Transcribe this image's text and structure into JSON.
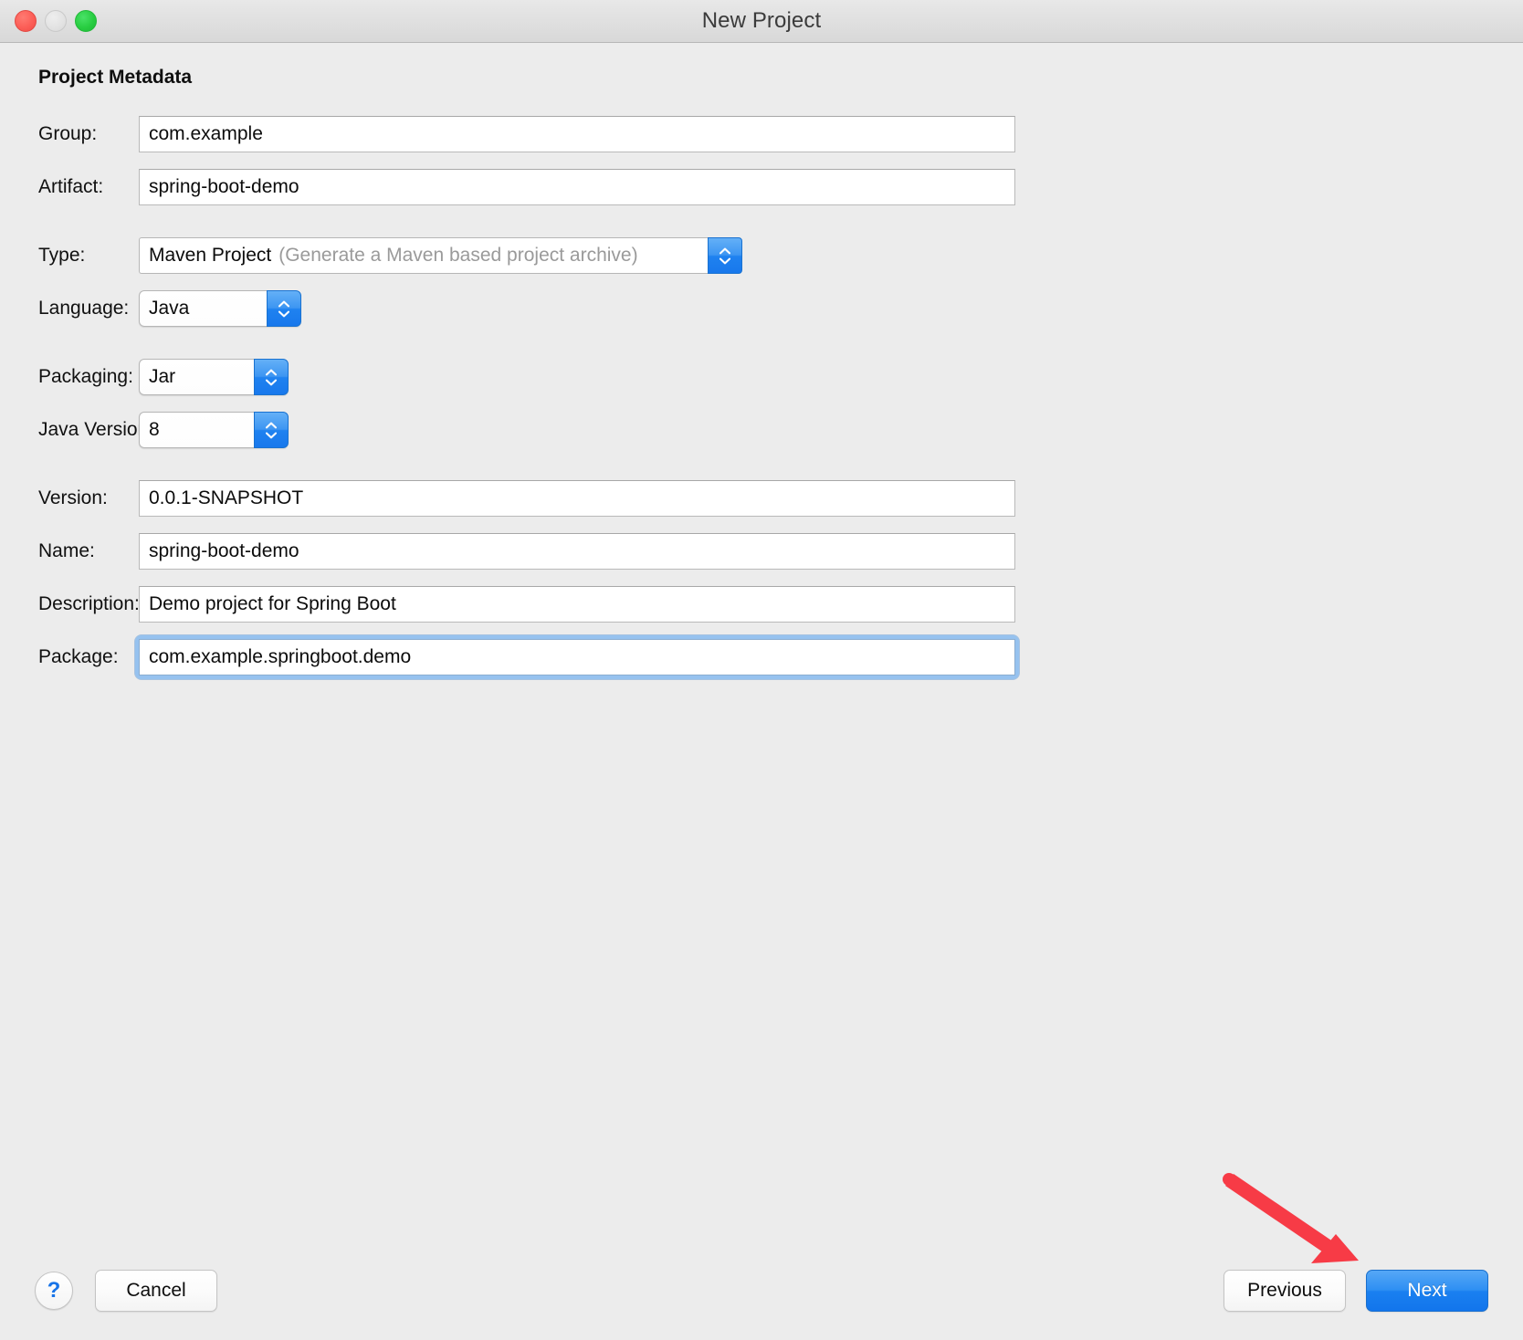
{
  "window": {
    "title": "New Project",
    "traffic_lights": [
      {
        "name": "close",
        "color": "#fc5e57"
      },
      {
        "name": "minimize",
        "color": "#e2e2e2"
      },
      {
        "name": "zoom",
        "color": "#28cd41"
      }
    ]
  },
  "section": {
    "title": "Project Metadata"
  },
  "form": {
    "fields": [
      {
        "label": "Group:",
        "value": "com.example",
        "type": "text"
      },
      {
        "label": "Artifact:",
        "value": "spring-boot-demo",
        "type": "text"
      },
      {
        "label": "Type:",
        "value": "Maven Project",
        "hint": "(Generate a Maven based project archive)",
        "type": "popup"
      },
      {
        "label": "Language:",
        "value": "Java",
        "type": "popup"
      },
      {
        "label": "Packaging:",
        "value": "Jar",
        "type": "popup"
      },
      {
        "label": "Java Version:",
        "value": "8",
        "type": "popup"
      },
      {
        "label": "Version:",
        "value": "0.0.1-SNAPSHOT",
        "type": "text"
      },
      {
        "label": "Name:",
        "value": "spring-boot-demo",
        "type": "text"
      },
      {
        "label": "Description:",
        "value": "Demo project for Spring Boot",
        "type": "text"
      },
      {
        "label": "Package:",
        "value": "com.example.springboot.demo",
        "type": "text",
        "focused": true
      }
    ]
  },
  "footer": {
    "help_label": "?",
    "cancel_label": "Cancel",
    "previous_label": "Previous",
    "next_label": "Next"
  },
  "annotation": {
    "arrow_color": "#f73b46",
    "points_to": "Next"
  },
  "colors": {
    "window_background": "#ececec",
    "titlebar_top": "#e8e8e8",
    "titlebar_bottom": "#d8d8d8",
    "accent_blue": "#1a80f0",
    "focus_ring": "#96c2ef",
    "hint_text": "#9a9a9a",
    "annotation_red": "#f73b46"
  }
}
